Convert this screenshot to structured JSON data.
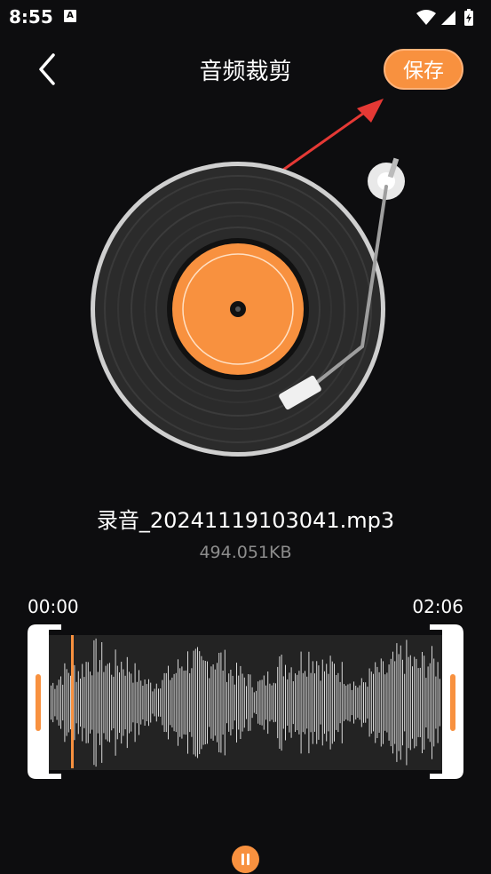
{
  "status_bar": {
    "time": "8:55",
    "notification_icon": "A"
  },
  "header": {
    "title": "音频裁剪",
    "save_label": "保存"
  },
  "file": {
    "name": "录音_20241119103041.mp3",
    "size": "494.051KB"
  },
  "trim": {
    "start_time": "00:00",
    "end_time": "02:06"
  },
  "colors": {
    "accent": "#f8913f",
    "background": "#0d0d0f",
    "arrow": "#e53935"
  },
  "icons": {
    "back": "chevron-left-icon",
    "wifi": "wifi-icon",
    "signal": "signal-icon",
    "battery": "battery-charging-icon",
    "play_pause": "pause-icon"
  }
}
